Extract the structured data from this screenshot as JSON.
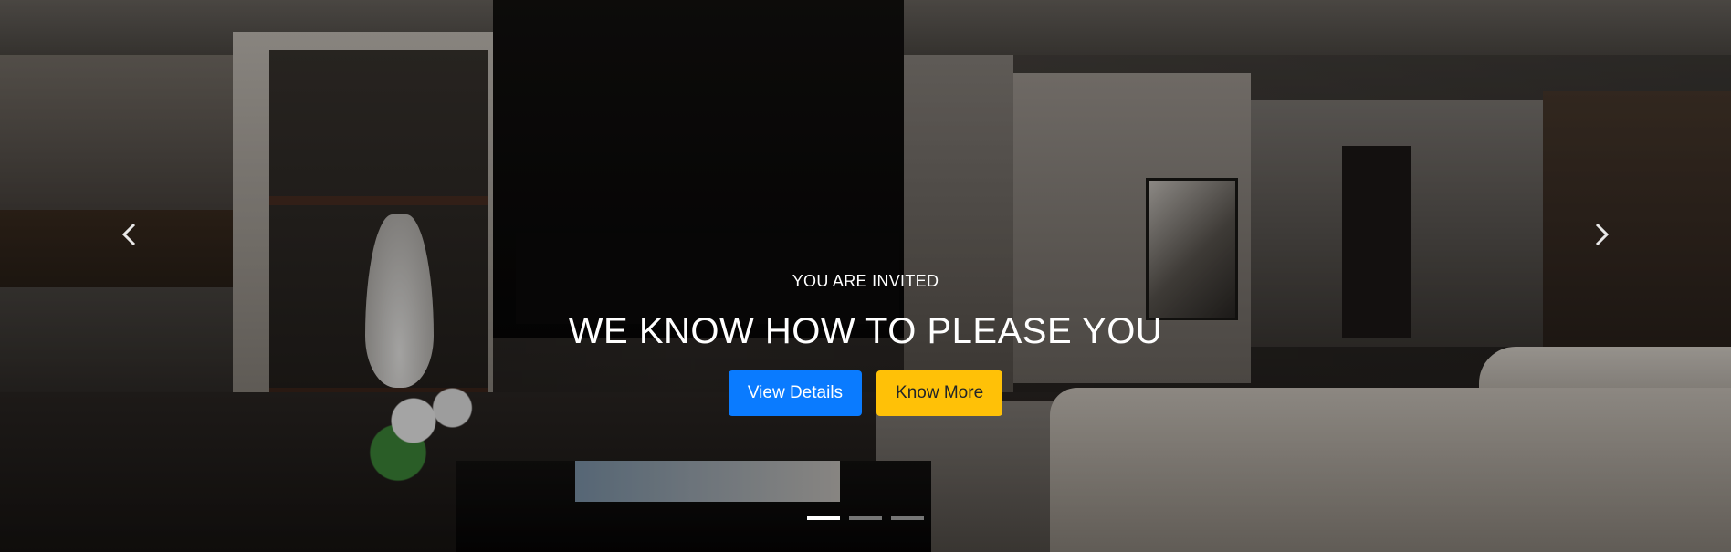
{
  "carousel": {
    "caption": {
      "subtitle": "YOU ARE INVITED",
      "headline": "WE KNOW HOW TO PLEASE YOU"
    },
    "buttons": {
      "view_details": "View Details",
      "know_more": "Know More"
    },
    "controls": {
      "prev_icon": "chevron-left-icon",
      "next_icon": "chevron-right-icon"
    },
    "indicators": {
      "count": 3,
      "active_index": 0
    },
    "colors": {
      "primary": "#0a7bff",
      "warning": "#ffc107",
      "caption_text": "#ffffff"
    }
  }
}
